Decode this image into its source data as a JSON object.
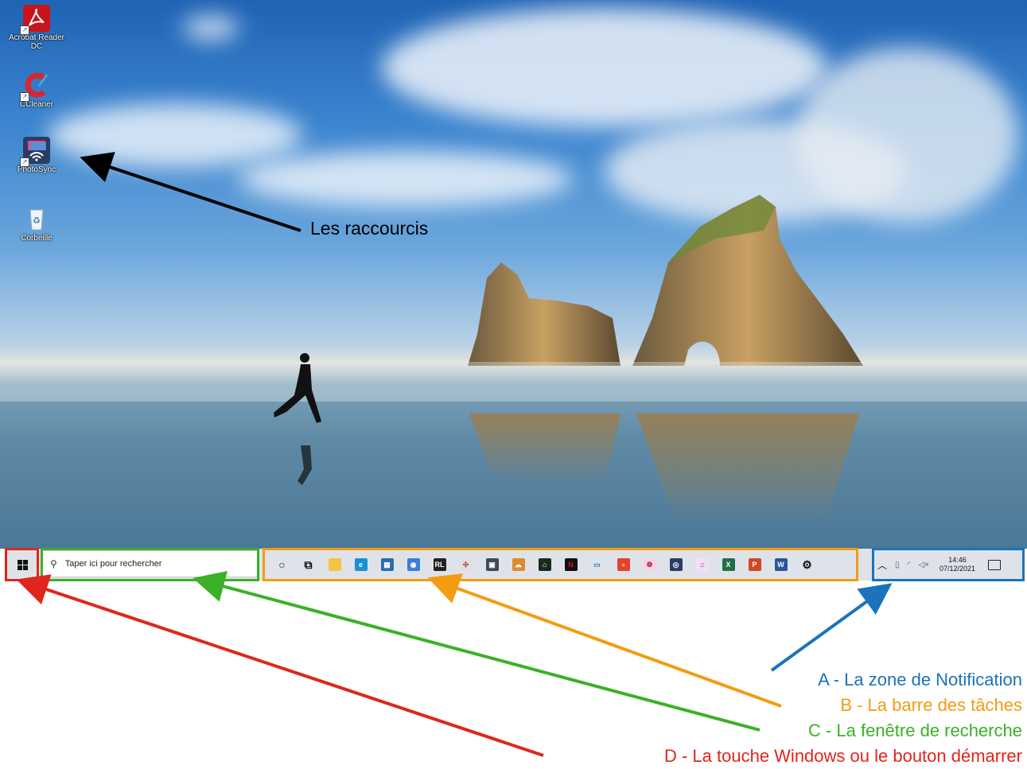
{
  "desktop": {
    "icons": [
      {
        "label": "Acrobat Reader DC",
        "icon": "acrobat-icon",
        "color": "#c4161c"
      },
      {
        "label": "CCleaner",
        "icon": "ccleaner-icon",
        "color": "#d9262e"
      },
      {
        "label": "PhotoSync",
        "icon": "photosync-icon",
        "color": "#2a3d64"
      },
      {
        "label": "Corbeille",
        "icon": "recycle-bin-icon",
        "color": "#e8eef3"
      }
    ]
  },
  "taskbar": {
    "search_placeholder": "Taper ici pour rechercher",
    "apps": [
      {
        "icon": "cortana-icon",
        "glyph": "○",
        "bg": "transparent",
        "fg": "#111"
      },
      {
        "icon": "task-view-icon",
        "glyph": "⧉",
        "bg": "transparent",
        "fg": "#111"
      },
      {
        "icon": "file-explorer-icon",
        "glyph": "",
        "bg": "#f4c542",
        "fg": "#fff"
      },
      {
        "icon": "edge-icon",
        "glyph": "e",
        "bg": "#1b8fd6",
        "fg": "#fff"
      },
      {
        "icon": "store-icon",
        "glyph": "▦",
        "bg": "#2b6cb0",
        "fg": "#fff"
      },
      {
        "icon": "github-icon",
        "glyph": "◉",
        "bg": "#3b7dd8",
        "fg": "#fff"
      },
      {
        "icon": "rl-app-icon",
        "glyph": "RL",
        "bg": "#222",
        "fg": "#fff"
      },
      {
        "icon": "pinwheel-app-icon",
        "glyph": "✣",
        "bg": "#e0e0e0",
        "fg": "#c0392b"
      },
      {
        "icon": "photos-app-icon",
        "glyph": "▣",
        "bg": "#3a4a5a",
        "fg": "#fff"
      },
      {
        "icon": "cloud-app-icon",
        "glyph": "☁",
        "bg": "#e0892f",
        "fg": "#fff"
      },
      {
        "icon": "home-app-icon",
        "glyph": "⌂",
        "bg": "#1a2a1a",
        "fg": "#fff"
      },
      {
        "icon": "netflix-icon",
        "glyph": "N",
        "bg": "#111",
        "fg": "#e50914"
      },
      {
        "icon": "screen-app-icon",
        "glyph": "▭",
        "bg": "#d8e4ee",
        "fg": "#4a6a8a"
      },
      {
        "icon": "chrome-icon",
        "glyph": "●",
        "bg": "#e34133",
        "fg": "#fbbc05"
      },
      {
        "icon": "spiral-app-icon",
        "glyph": "❁",
        "bg": "#f3d5e0",
        "fg": "#c0396b"
      },
      {
        "icon": "photosync-icon",
        "glyph": "◎",
        "bg": "#2a3d64",
        "fg": "#fff"
      },
      {
        "icon": "itunes-icon",
        "glyph": "♫",
        "bg": "#f0e0f4",
        "fg": "#b43fc8"
      },
      {
        "icon": "excel-icon",
        "glyph": "X",
        "bg": "#1e7145",
        "fg": "#fff"
      },
      {
        "icon": "powerpoint-icon",
        "glyph": "P",
        "bg": "#d24726",
        "fg": "#fff"
      },
      {
        "icon": "word-icon",
        "glyph": "W",
        "bg": "#2b579a",
        "fg": "#fff"
      },
      {
        "icon": "settings-icon",
        "glyph": "⚙",
        "bg": "transparent",
        "fg": "#111"
      }
    ],
    "tray": {
      "time": "14:46",
      "date": "07/12/2021"
    }
  },
  "annotations": {
    "shortcuts": {
      "text": "Les raccourcis",
      "color": "#000000"
    },
    "notification": {
      "text": "A - La zone de Notification",
      "color": "#1a73bb"
    },
    "taskbar": {
      "text": "B - La barre des tâches",
      "color": "#f39c12"
    },
    "search": {
      "text": "C - La fenêtre de recherche",
      "color": "#3cb028"
    },
    "start": {
      "text": "D - La touche Windows ou le bouton démarrer",
      "color": "#e0261c"
    }
  }
}
